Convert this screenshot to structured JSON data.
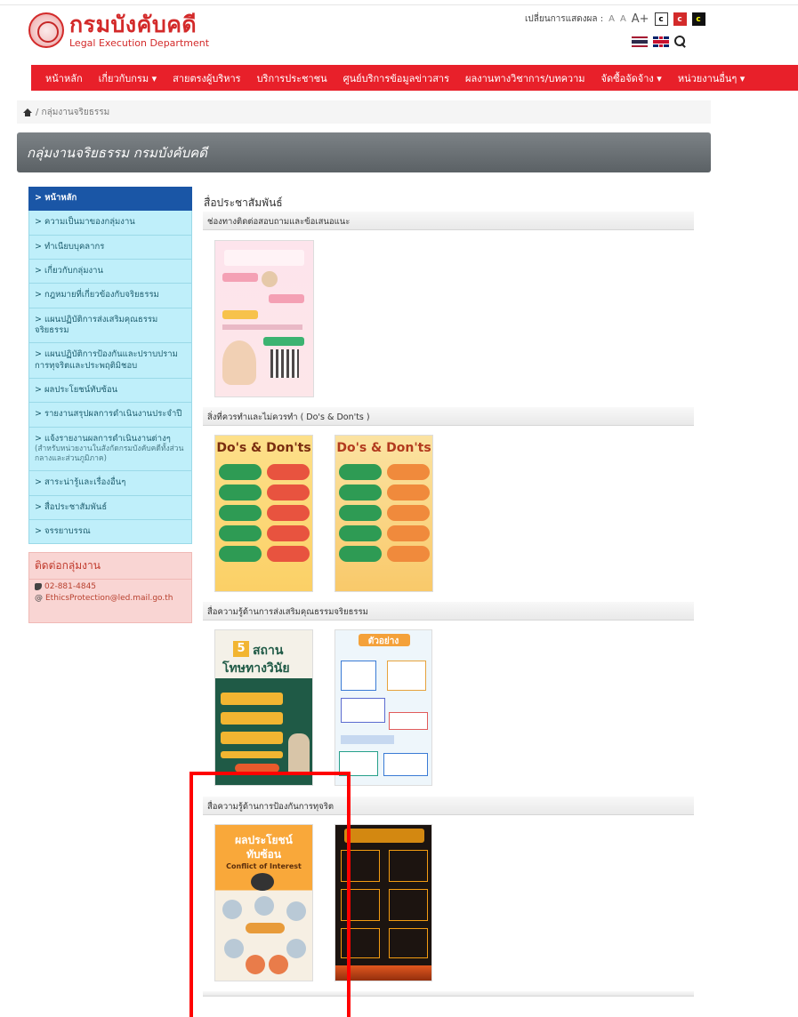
{
  "header": {
    "logo_th": "กรมบังคับคดี",
    "logo_en": "Legal Execution Department",
    "font_label": "เปลี่ยนการแสดงผล :",
    "font_sizes": [
      "A",
      "A",
      "A+"
    ],
    "contrast": [
      "c",
      "c",
      "c"
    ]
  },
  "nav": [
    "หน้าหลัก",
    "เกี่ยวกับกรม ▾",
    "สายตรงผู้บริหาร",
    "บริการประชาชน",
    "ศูนย์บริการข้อมูลข่าวสาร",
    "ผลงานทางวิชาการ/บทความ",
    "จัดซื้อจัดจ้าง ▾",
    "หน่วยงานอื่นๆ ▾"
  ],
  "breadcrumb": "/ กลุ่มงานจริยธรรม",
  "page_title": "กลุ่มงานจริยธรรม กรมบังคับคดี",
  "sidebar": [
    {
      "label": "> หน้าหลัก",
      "sub": ""
    },
    {
      "label": "> ความเป็นมาของกลุ่มงาน",
      "sub": ""
    },
    {
      "label": "> ทำเนียบบุคลากร",
      "sub": ""
    },
    {
      "label": "> เกี่ยวกับกลุ่มงาน",
      "sub": ""
    },
    {
      "label": "> กฎหมายที่เกี่ยวข้องกับจริยธรรม",
      "sub": ""
    },
    {
      "label": "> แผนปฏิบัติการส่งเสริมคุณธรรม จริยธรรม",
      "sub": ""
    },
    {
      "label": "> แผนปฏิบัติการป้องกันและปราบปรามการทุจริตและประพฤติมิชอบ",
      "sub": ""
    },
    {
      "label": "> ผลประโยชน์ทับซ้อน",
      "sub": ""
    },
    {
      "label": "> รายงานสรุปผลการดำเนินงานประจำปี",
      "sub": ""
    },
    {
      "label": "> แจ้งรายงานผลการดำเนินงานต่างๆ",
      "sub": "(สำหรับหน่วยงานในสังกัดกรมบังคับคดีทั้งส่วนกลางและส่วนภูมิภาค)"
    },
    {
      "label": "> สาระน่ารู้และเรื่องอื่นๆ",
      "sub": ""
    },
    {
      "label": "> สื่อประชาสัมพันธ์",
      "sub": ""
    },
    {
      "label": "> จรรยาบรรณ",
      "sub": ""
    }
  ],
  "contact": {
    "title": "ติดต่อกลุ่มงาน",
    "phone": "02-881-4845",
    "email": "EthicsProtection@led.mail.go.th"
  },
  "main": {
    "heading": "สื่อประชาสัมพันธ์",
    "sections": [
      "ช่องทางติดต่อสอบถามและข้อเสนอแนะ",
      "สิ่งที่ควรทำและไม่ควรทำ ( Do's & Don'ts )",
      "สื่อความรู้ด้านการส่งเสริมคุณธรรมจริยธรรม",
      "สื่อความรู้ด้านการป้องกันการทุจริต"
    ]
  },
  "posters": {
    "dos_title": "Do's & Don'ts",
    "five_number": "5",
    "five_title": "สถาน",
    "five_title2": "โทษทางวินัย",
    "example_title": "ตัวอย่าง",
    "coi_title": "ผลประโยชน์",
    "coi_title2": "ทับซ้อน",
    "coi_en": "Conflict of Interest"
  },
  "colors": {
    "brand_red": "#e8202a",
    "sidebar_bg": "#bfeffa",
    "sidebar_active": "#1a56a6",
    "highlight_frame": "#ff0000"
  }
}
